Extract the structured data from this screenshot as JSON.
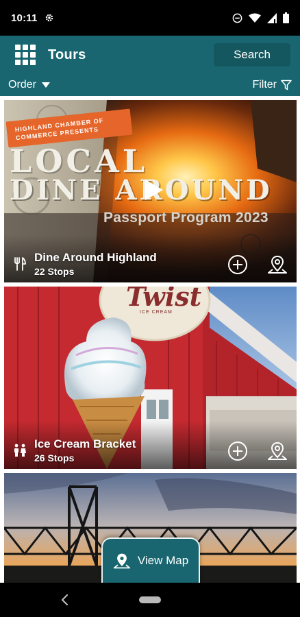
{
  "status_bar": {
    "time": "10:11",
    "icons": [
      "gear-icon",
      "do-not-disturb-icon",
      "wifi-icon",
      "signal-icon",
      "battery-icon"
    ]
  },
  "app_bar": {
    "title": "Tours",
    "search_label": "Search",
    "menu_icon": "grid-icon"
  },
  "toolbar": {
    "order_label": "Order",
    "filter_label": "Filter"
  },
  "tours": [
    {
      "name": "Dine Around Highland",
      "stops": "22 Stops",
      "category_icon": "fork-knife-icon",
      "poster": {
        "ribbon_line1": "HIGHLAND CHAMBER OF",
        "ribbon_line2": "COMMERCE PRESENTS",
        "headline1": "LOCAL",
        "headline2": "DINE AROUND",
        "subtitle": "Passport Program 2023"
      }
    },
    {
      "name": "Ice Cream Bracket",
      "stops": "26 Stops",
      "category_icon": "family-icon",
      "poster": {
        "sign_text": "Twist",
        "sign_sub": "ICE CREAM"
      }
    },
    {
      "name": "",
      "stops": "",
      "category_icon": ""
    }
  ],
  "view_map": {
    "label": "View Map"
  },
  "colors": {
    "primary": "#196670",
    "primary_dark": "#15575f"
  }
}
